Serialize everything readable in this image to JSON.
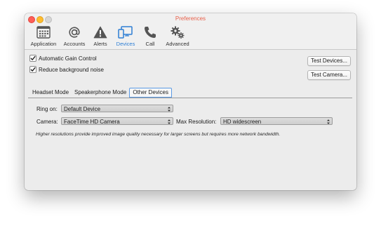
{
  "window": {
    "title": "Preferences"
  },
  "toolbar": {
    "items": [
      {
        "label": "Application",
        "icon": "application-icon"
      },
      {
        "label": "Accounts",
        "icon": "at-sign-icon"
      },
      {
        "label": "Alerts",
        "icon": "alert-icon"
      },
      {
        "label": "Devices",
        "icon": "devices-icon",
        "active": true
      },
      {
        "label": "Call",
        "icon": "phone-icon"
      },
      {
        "label": "Advanced",
        "icon": "gears-icon"
      }
    ]
  },
  "options": {
    "agc": {
      "label": "Automatic Gain Control",
      "checked": true
    },
    "noise": {
      "label": "Reduce background noise",
      "checked": true
    }
  },
  "buttons": {
    "test_devices": "Test Devices...",
    "test_camera": "Test Camera..."
  },
  "tabs": {
    "items": [
      "Headset Mode",
      "Speakerphone Mode",
      "Other Devices"
    ],
    "active": "Other Devices"
  },
  "fields": {
    "ring_on": {
      "label": "Ring on:",
      "value": "Default Device"
    },
    "camera": {
      "label": "Camera:",
      "value": "FaceTime HD Camera"
    },
    "max_resolution": {
      "label": "Max Resolution:",
      "value": "HD widescreen"
    }
  },
  "note": "Higher resolutions provide improved image quality necessary for larger screens but requires more network bandwidth.",
  "colors": {
    "accent": "#2d7ed4",
    "title": "#e8604a",
    "close": "#fe5f57",
    "minimize": "#febc2e"
  }
}
